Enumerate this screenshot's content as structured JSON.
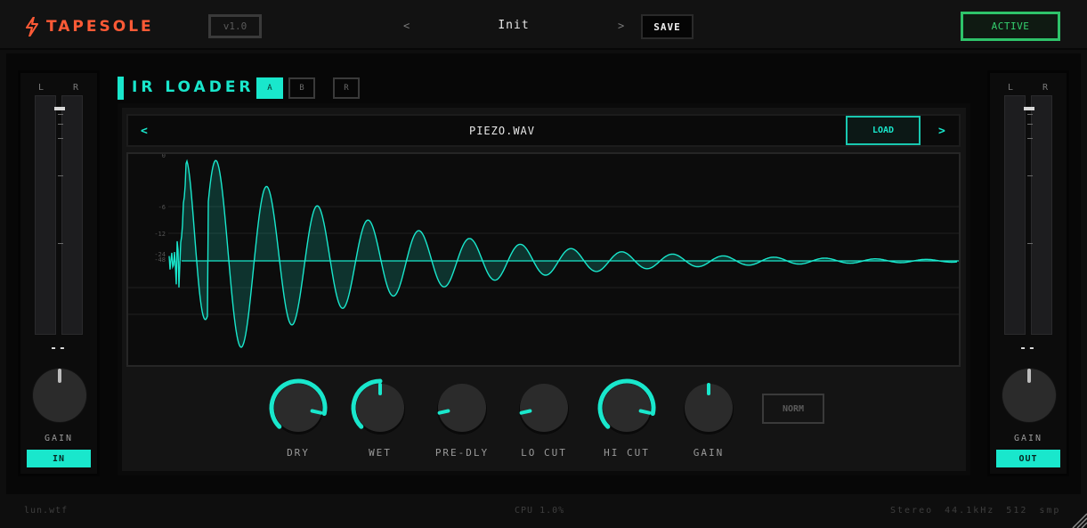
{
  "header": {
    "brand": "TAPESOLE",
    "version": "v1.0",
    "preset_prev": "<",
    "preset_name": "Init",
    "preset_next": ">",
    "save_label": "SAVE",
    "active_label": "ACTIVE"
  },
  "colors": {
    "accent": "#19e7cc",
    "brand": "#ff5a36",
    "active": "#35d06f",
    "background": "#0e0e0e"
  },
  "input_meter": {
    "left_label": "L",
    "right_label": "R",
    "value": "--",
    "gain_label": "GAIN",
    "button_label": "IN"
  },
  "output_meter": {
    "left_label": "L",
    "right_label": "R",
    "value": "--",
    "gain_label": "GAIN",
    "button_label": "OUT"
  },
  "ir_loader": {
    "title": "IR LOADER",
    "slots": [
      "A",
      "B",
      "R"
    ],
    "active_slot": "A",
    "file_prev": "<",
    "file_name": "PIEZO.WAV",
    "file_next": ">",
    "load_label": "LOAD",
    "db_labels": [
      "0",
      "-6",
      "-12",
      "-24",
      "-48"
    ]
  },
  "knobs": [
    {
      "label": "DRY",
      "value": 0.88,
      "active": true
    },
    {
      "label": "WET",
      "value": 0.5,
      "active": true
    },
    {
      "label": "PRE-DLY",
      "value": 0.12,
      "active": false
    },
    {
      "label": "LO CUT",
      "value": 0.12,
      "active": false
    },
    {
      "label": "HI CUT",
      "value": 0.88,
      "active": true
    },
    {
      "label": "GAIN",
      "value": 0.5,
      "active": false
    }
  ],
  "norm_label": "NORM",
  "footer": {
    "left": "lun.wtf",
    "center": "CPU 1.0%",
    "right": "Stereo 44.1kHz 512 smp"
  }
}
